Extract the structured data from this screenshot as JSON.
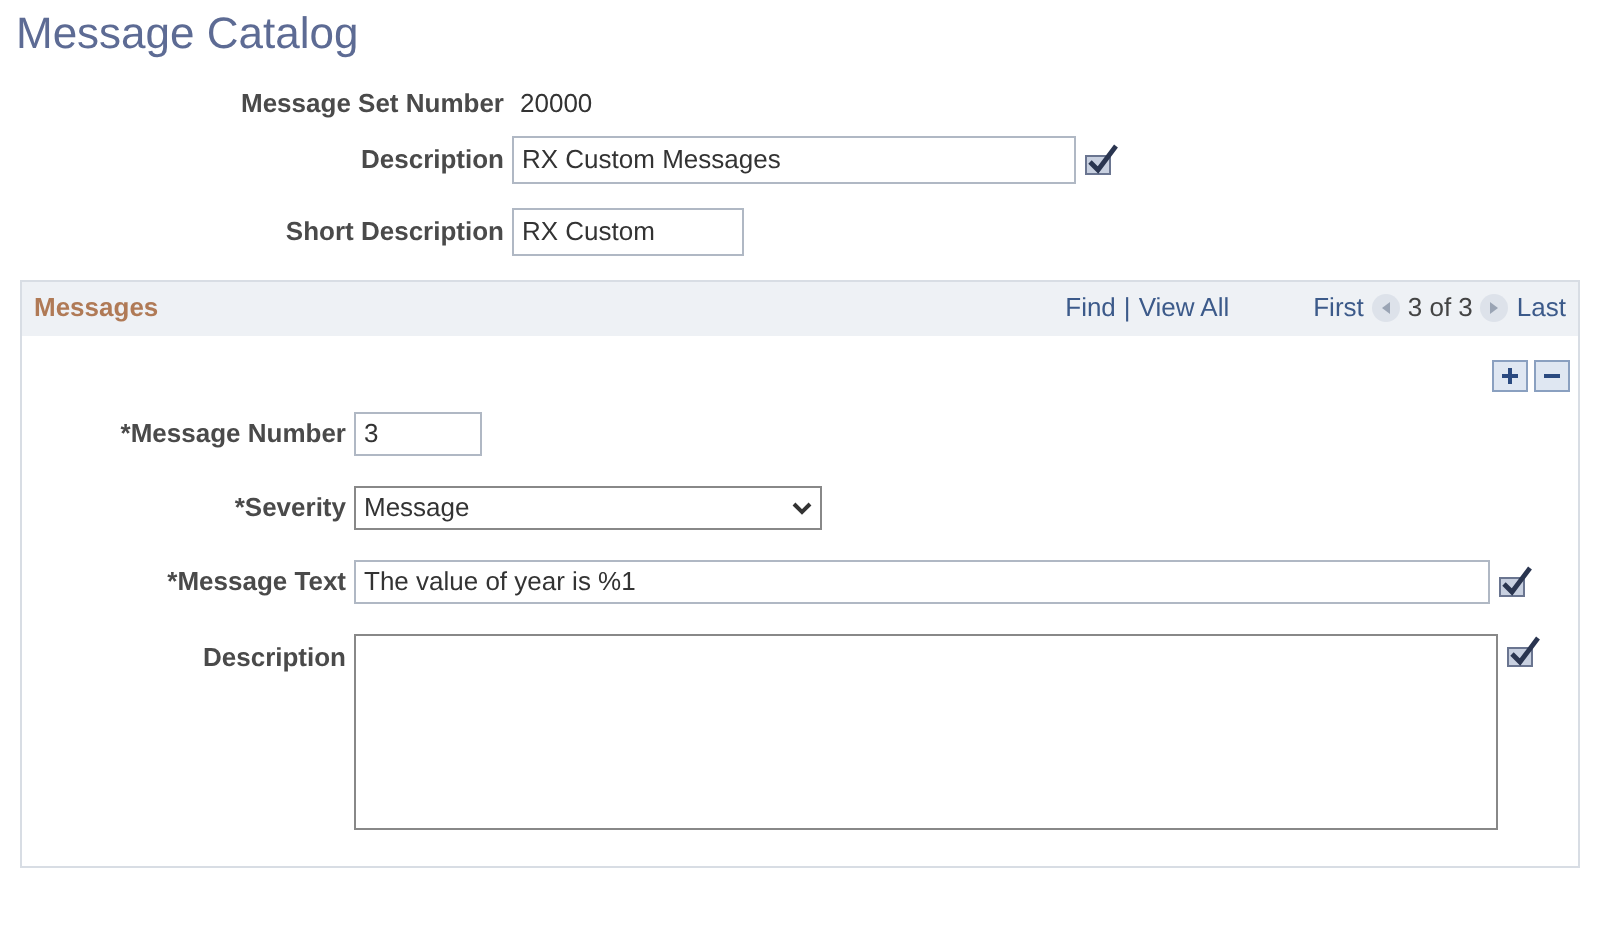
{
  "title": "Message Catalog",
  "header": {
    "set_number": {
      "label": "Message Set Number",
      "value": "20000"
    },
    "description": {
      "label": "Description",
      "value": "RX Custom Messages"
    },
    "short_description": {
      "label": "Short Description",
      "value": "RX Custom"
    }
  },
  "messages": {
    "title": "Messages",
    "find": "Find",
    "separator": "|",
    "view_all": "View All",
    "first": "First",
    "counter": "3 of 3",
    "last": "Last",
    "fields": [
      {
        "kind": "number",
        "label": "*Message Number",
        "value": "3"
      },
      {
        "kind": "select",
        "label": "*Severity",
        "value": "Message"
      },
      {
        "kind": "text",
        "label": "*Message Text",
        "value": "The value of year is %1"
      },
      {
        "kind": "textarea",
        "label": "Description"
      }
    ]
  }
}
